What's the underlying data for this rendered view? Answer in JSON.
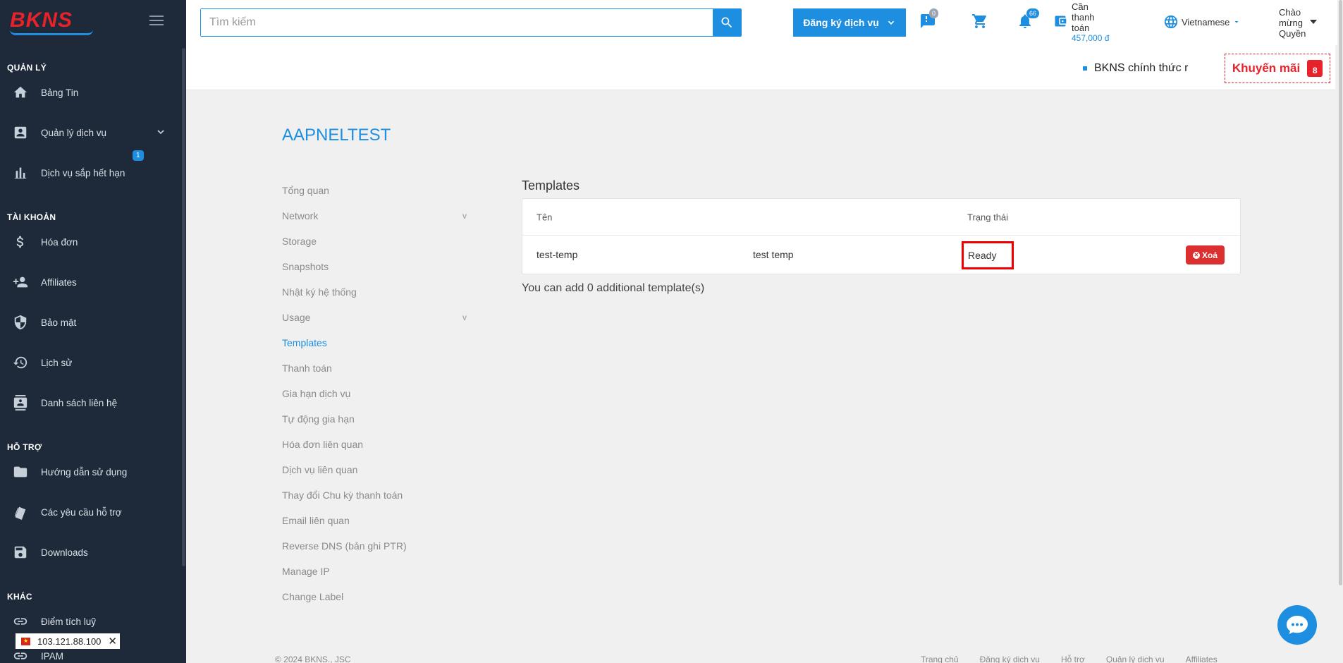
{
  "brand": {
    "logo_text": "BKNS"
  },
  "sidebar": {
    "sections": [
      {
        "title": "QUẢN LÝ"
      },
      {
        "title": "TÀI KHOẢN"
      },
      {
        "title": "HỖ TRỢ"
      },
      {
        "title": "KHÁC"
      }
    ],
    "items": [
      {
        "label": "Bảng Tin",
        "icon": "home-icon"
      },
      {
        "label": "Quản lý dịch vụ",
        "icon": "account-box-icon"
      },
      {
        "label": "Dịch vụ sắp hết hạn",
        "icon": "bar-chart-icon",
        "badge": "1"
      },
      {
        "label": "Hóa đơn",
        "icon": "dollar-icon"
      },
      {
        "label": "Affiliates",
        "icon": "person-add-icon"
      },
      {
        "label": "Bảo mật",
        "icon": "shield-icon"
      },
      {
        "label": "Lịch sử",
        "icon": "history-icon"
      },
      {
        "label": "Danh sách liên hệ",
        "icon": "contact-icon"
      },
      {
        "label": "Hướng dẫn sử dụng",
        "icon": "folder-icon"
      },
      {
        "label": "Các yêu cầu hỗ trợ",
        "icon": "ticket-icon"
      },
      {
        "label": "Downloads",
        "icon": "save-icon"
      },
      {
        "label": "Điểm tích luỹ",
        "icon": "link-icon"
      },
      {
        "label": "IPAM",
        "icon": "link-icon"
      }
    ],
    "ip_tag": "103.121.88.100"
  },
  "topbar": {
    "search_placeholder": "Tìm kiếm",
    "register_label": "Đăng ký dịch vụ",
    "chat_badge": "0",
    "notif_badge": "66",
    "pay_label_1": "Cần",
    "pay_label_2": "thanh",
    "pay_label_3": "toán",
    "pay_amount": "457,000 đ",
    "language": "Vietnamese",
    "greet_1": "Chào",
    "greet_2": "mừng",
    "greet_3": "Quyền"
  },
  "promo": {
    "ticker": "BKNS chính thức ra",
    "khuyenmai": "Khuyến mãi",
    "gift_count": "8"
  },
  "main": {
    "title": "AAPNELTEST",
    "subnav": [
      {
        "label": "Tổng quan"
      },
      {
        "label": "Network",
        "chevron": "v"
      },
      {
        "label": "Storage"
      },
      {
        "label": "Snapshots"
      },
      {
        "label": "Nhật ký hệ thống"
      },
      {
        "label": "Usage",
        "chevron": "v"
      },
      {
        "label": "Templates",
        "active": true
      },
      {
        "label": "Thanh toán"
      },
      {
        "label": "Gia hạn dịch vụ"
      },
      {
        "label": "Tự động gia hạn"
      },
      {
        "label": "Hóa đơn liên quan"
      },
      {
        "label": "Dịch vụ liên quan"
      },
      {
        "label": "Thay đổi Chu kỳ thanh toán"
      },
      {
        "label": "Email liên quan"
      },
      {
        "label": "Reverse DNS (bản ghi PTR)"
      },
      {
        "label": "Manage IP"
      },
      {
        "label": "Change Label"
      }
    ],
    "section_title": "Templates",
    "table": {
      "headers": {
        "name": "Tên",
        "status": "Trạng thái"
      },
      "rows": [
        {
          "name": "test-temp",
          "description": "test temp",
          "status": "Ready",
          "delete_label": "Xoá"
        }
      ]
    },
    "info": "You can add 0 additional template(s)"
  },
  "footer": {
    "copyright": "© 2024 BKNS., JSC",
    "links": [
      "Trang chủ",
      "Đăng ký dịch vụ",
      "Hỗ trợ",
      "Quản lý dịch vụ",
      "Affiliates"
    ]
  },
  "colors": {
    "accent": "#1e8ee0",
    "sidebar_bg": "#1e2a3a",
    "danger": "#dc2f2f",
    "brand_red": "#e8222a"
  }
}
